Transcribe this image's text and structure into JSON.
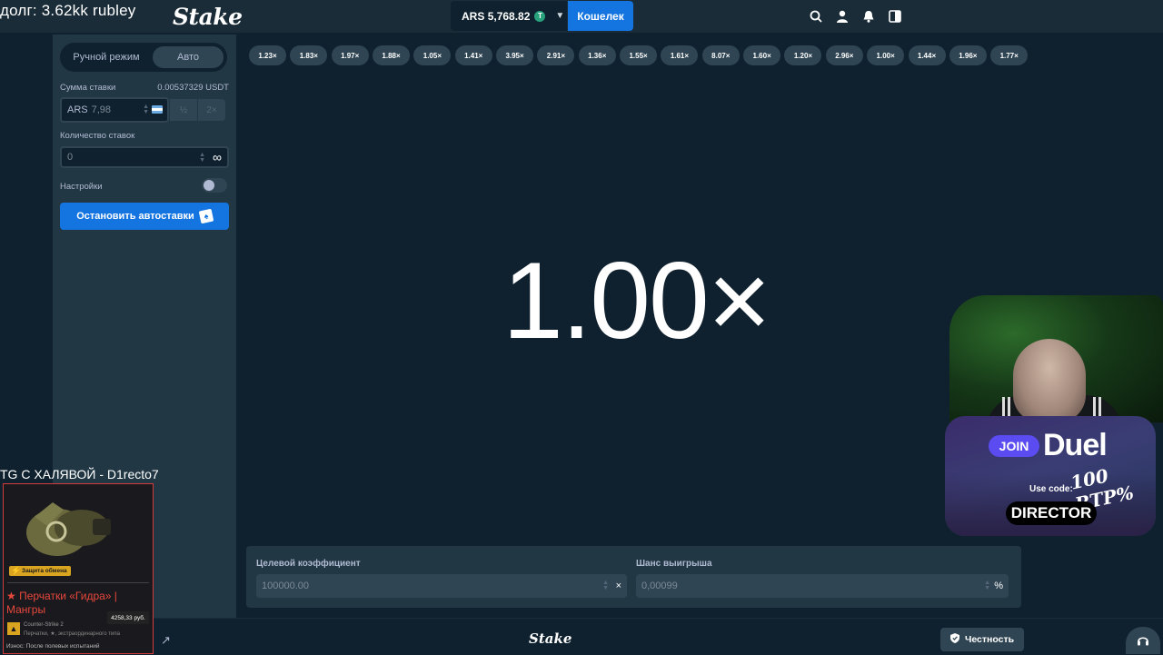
{
  "stream": {
    "debt_text": "долг: 3.62kk rubley",
    "tg_text": "TG С ХАЛЯВОЙ - D1recto7"
  },
  "header": {
    "logo": "Stake",
    "balance_currency": "ARS",
    "balance_value": "5,768.82",
    "currency_icon": "T",
    "wallet_label": "Кошелек",
    "icons": [
      "search-icon",
      "user-icon",
      "bell-icon",
      "sidebar-toggle-icon"
    ]
  },
  "sidebar": {
    "mode_manual": "Ручной режим",
    "mode_auto": "Авто",
    "bet_amount_label": "Сумма ставки",
    "bet_amount_usdt": "0.00537329 USDT",
    "bet_currency": "ARS",
    "bet_value": "7,98",
    "half_label": "½",
    "double_label": "2×",
    "bets_count_label": "Количество ставок",
    "bets_count_value": "0",
    "infinity": "∞",
    "settings_label": "Настройки",
    "stop_button": "Остановить автоставки"
  },
  "game": {
    "history": [
      "1.23×",
      "1.83×",
      "1.97×",
      "1.88×",
      "1.05×",
      "1.41×",
      "3.95×",
      "2.91×",
      "1.36×",
      "1.55×",
      "1.61×",
      "8.07×",
      "1.60×",
      "1.20×",
      "2.96×",
      "1.00×",
      "1.44×",
      "1.96×",
      "1.77×"
    ],
    "multiplier": "1.00×",
    "target_label": "Целевой коэффициент",
    "target_value": "100000.00",
    "target_suffix": "×",
    "chance_label": "Шанс выигрыша",
    "chance_value": "0,00099",
    "chance_suffix": "%"
  },
  "footer": {
    "logo": "Stake",
    "fairness": "Честность"
  },
  "item_card": {
    "badge": "Защита обмена",
    "name": "★ Перчатки «Гидра» | Мангры",
    "price": "4258,33 руб.",
    "game": "Counter-Strike 2",
    "type": "Перчатки, ★, экстраординарного типа",
    "wear": "Износ: После полевых испытаний"
  },
  "promo": {
    "join": "JOIN",
    "brand": "Duel",
    "rtp": "100 RTP%",
    "use_code": "Use code:",
    "code": "DIRECTOR"
  },
  "colors": {
    "bg": "#0f212e",
    "panel": "#213743",
    "pill": "#2f4553",
    "accent": "#1475e1"
  }
}
